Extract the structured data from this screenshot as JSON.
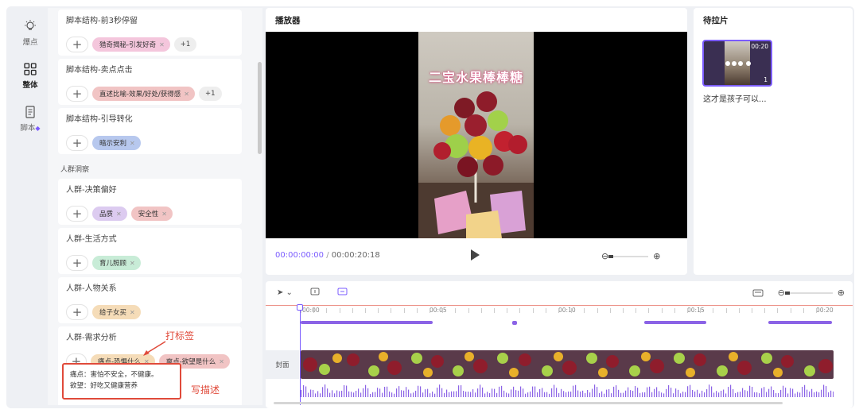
{
  "rail": [
    {
      "label": "爆点",
      "icon": "bulb-icon"
    },
    {
      "label": "整体",
      "icon": "grid-icon"
    },
    {
      "label": "脚本",
      "icon": "script-icon",
      "badge": "gem-icon"
    }
  ],
  "script": {
    "cards": [
      {
        "title": "脚本结构-前3秒停留",
        "tags": [
          {
            "label": "猎奇揭秘-引发好奇",
            "color": "pink"
          }
        ],
        "more": "+1"
      },
      {
        "title": "脚本结构-卖点点击",
        "tags": [
          {
            "label": "直述比喻-效果/好处/获得感",
            "color": "red"
          }
        ],
        "more": "+1"
      },
      {
        "title": "脚本结构-引导转化",
        "tags": [
          {
            "label": "暗示安利",
            "color": "blue"
          }
        ]
      }
    ],
    "section_label": "人群洞察",
    "people_cards": [
      {
        "title": "人群-决策偏好",
        "tags": [
          {
            "label": "品质",
            "color": "purple"
          },
          {
            "label": "安全性",
            "color": "red"
          }
        ]
      },
      {
        "title": "人群-生活方式",
        "tags": [
          {
            "label": "育儿照顾",
            "color": "green"
          }
        ]
      },
      {
        "title": "人群-人物关系",
        "tags": [
          {
            "label": "给子女买",
            "color": "yellow"
          }
        ]
      },
      {
        "title": "人群-需求分析",
        "tags": [
          {
            "label": "痛点-恐惧什么",
            "color": "yellow"
          },
          {
            "label": "爽点-欲望是什么",
            "color": "red"
          }
        ]
      }
    ],
    "description_lines": [
      "痛点：害怕不安全，不健康。",
      "欲望：好吃又健康营养"
    ],
    "annot_tag": "打标签",
    "annot_desc": "写描述"
  },
  "player": {
    "title": "播放器",
    "video_caption": "二宝水果棒棒糖",
    "current_time": "00:00:00:00",
    "separator": "/",
    "total_time": "00:00:20:18"
  },
  "pending": {
    "title": "待拉片",
    "items": [
      {
        "duration": "00:20",
        "count": "1",
        "label": "这才是孩子可以..."
      }
    ]
  },
  "timeline": {
    "ruler_labels": [
      "00:00",
      "00:05",
      "00:10",
      "00:15",
      "00:20"
    ],
    "cover_label": "封面"
  },
  "colors": {
    "accent": "#7b5cff",
    "annotation": "#e04a3a"
  }
}
